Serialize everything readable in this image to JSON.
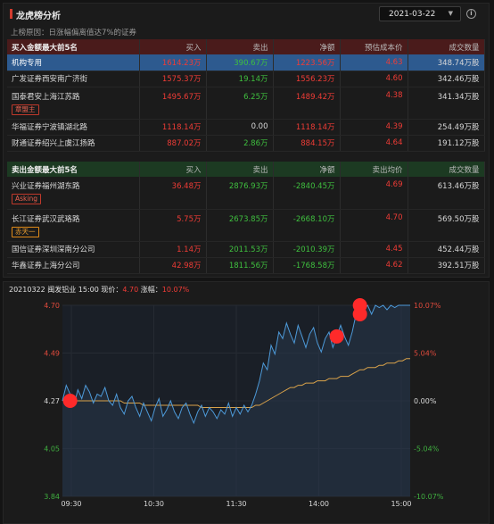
{
  "header": {
    "title": "龙虎榜分析",
    "date": "2021-03-22",
    "reason": "上榜原因：日涨幅偏离值达7%的证券"
  },
  "buy_table": {
    "columns": [
      "买入金额最大前5名",
      "买入",
      "卖出",
      "净额",
      "预估成本价",
      "成交数量"
    ],
    "rows": [
      {
        "name": "机构专用",
        "buy": "1614.23万",
        "sell": "390.67万",
        "net": "1223.56万",
        "cost": "4.63",
        "volume": "348.74万股",
        "selected": true,
        "tag": ""
      },
      {
        "name": "广发证券西安南广济街",
        "buy": "1575.37万",
        "sell": "19.14万",
        "net": "1556.23万",
        "cost": "4.60",
        "volume": "342.46万股",
        "selected": false,
        "tag": ""
      },
      {
        "name": "国泰君安上海江苏路",
        "buy": "1495.67万",
        "sell": "6.25万",
        "net": "1489.42万",
        "cost": "4.38",
        "volume": "341.34万股",
        "selected": false,
        "tag": "章盟主"
      },
      {
        "name": "华福证券宁波镇湖北路",
        "buy": "1118.14万",
        "sell": "0.00",
        "net": "1118.14万",
        "cost": "4.39",
        "volume": "254.49万股",
        "selected": false,
        "tag": ""
      },
      {
        "name": "财通证券绍兴上虞江扬路",
        "buy": "887.02万",
        "sell": "2.86万",
        "net": "884.15万",
        "cost": "4.64",
        "volume": "191.12万股",
        "selected": false,
        "tag": ""
      }
    ]
  },
  "sell_table": {
    "columns": [
      "卖出金额最大前5名",
      "买入",
      "卖出",
      "净额",
      "卖出均价",
      "成交数量"
    ],
    "rows": [
      {
        "name": "兴业证券福州湖东路",
        "buy": "36.48万",
        "sell": "2876.93万",
        "net": "-2840.45万",
        "cost": "4.69",
        "volume": "613.46万股",
        "tag": "Asking",
        "tag_style": "red"
      },
      {
        "name": "长江证券武汉武珞路",
        "buy": "5.75万",
        "sell": "2673.85万",
        "net": "-2668.10万",
        "cost": "4.70",
        "volume": "569.50万股",
        "tag": "赤天一",
        "tag_style": "orange"
      },
      {
        "name": "国信证券深圳深南分公司",
        "buy": "1.14万",
        "sell": "2011.53万",
        "net": "-2010.39万",
        "cost": "4.45",
        "volume": "452.44万股",
        "tag": ""
      },
      {
        "name": "华鑫证券上海分公司",
        "buy": "42.98万",
        "sell": "1811.56万",
        "net": "-1768.58万",
        "cost": "4.62",
        "volume": "392.51万股",
        "tag": ""
      }
    ]
  },
  "chart_info": {
    "prefix": "20210322 闽发铝业 15:00 现价：",
    "price": "4.70",
    "change_label": " 涨幅：",
    "change": "10.07%"
  },
  "chart_data": {
    "type": "line",
    "y_left_ticks": [
      "4.70",
      "4.49",
      "4.27",
      "4.05",
      "3.84"
    ],
    "y_right_ticks": [
      "10.07%",
      "5.04%",
      "0.00%",
      "-5.04%",
      "-10.07%"
    ],
    "x_ticks": [
      "09:30",
      "10:30",
      "11:30",
      "14:00",
      "15:00"
    ],
    "ylim": [
      3.84,
      4.7
    ],
    "prev_close": 4.27,
    "colors": {
      "price": "#4d9ad9",
      "avg": "#d9a24a",
      "marker": "#ff2a2a"
    },
    "series": [
      {
        "values": [
          4.27,
          4.34,
          4.3,
          4.25,
          4.32,
          4.28,
          4.34,
          4.31,
          4.26,
          4.3,
          4.29,
          4.33,
          4.27,
          4.25,
          4.3,
          4.24,
          4.21,
          4.27,
          4.29,
          4.24,
          4.2,
          4.26,
          4.22,
          4.18,
          4.24,
          4.28,
          4.2,
          4.23,
          4.27,
          4.22,
          4.19,
          4.24,
          4.26,
          4.21,
          4.17,
          4.22,
          4.25,
          4.2,
          4.24,
          4.22,
          4.19,
          4.23,
          4.21,
          4.26,
          4.2,
          4.24,
          4.21,
          4.25,
          4.22,
          4.25,
          4.3,
          4.36,
          4.44,
          4.41,
          4.52,
          4.48,
          4.58,
          4.55,
          4.62,
          4.57,
          4.53,
          4.61,
          4.56,
          4.51,
          4.57,
          4.6,
          4.53,
          4.49,
          4.55,
          4.58,
          4.51,
          4.56,
          4.61,
          4.56,
          4.52,
          4.58,
          4.66,
          4.7,
          4.68,
          4.7,
          4.66,
          4.7,
          4.69,
          4.7,
          4.68,
          4.7,
          4.69,
          4.7,
          4.7,
          4.7,
          4.7
        ]
      },
      {
        "values": [
          4.27,
          4.28,
          4.28,
          4.27,
          4.27,
          4.27,
          4.27,
          4.27,
          4.27,
          4.27,
          4.27,
          4.27,
          4.27,
          4.27,
          4.27,
          4.27,
          4.26,
          4.26,
          4.26,
          4.26,
          4.26,
          4.25,
          4.25,
          4.25,
          4.25,
          4.25,
          4.25,
          4.25,
          4.25,
          4.25,
          4.25,
          4.25,
          4.25,
          4.25,
          4.25,
          4.25,
          4.24,
          4.24,
          4.24,
          4.24,
          4.24,
          4.24,
          4.24,
          4.24,
          4.24,
          4.24,
          4.24,
          4.24,
          4.24,
          4.24,
          4.25,
          4.25,
          4.26,
          4.27,
          4.28,
          4.29,
          4.3,
          4.31,
          4.32,
          4.33,
          4.33,
          4.34,
          4.34,
          4.35,
          4.35,
          4.35,
          4.36,
          4.36,
          4.36,
          4.37,
          4.37,
          4.37,
          4.38,
          4.38,
          4.38,
          4.39,
          4.4,
          4.41,
          4.41,
          4.42,
          4.42,
          4.42,
          4.43,
          4.43,
          4.44,
          4.44,
          4.44,
          4.45,
          4.45,
          4.46,
          4.46
        ]
      }
    ],
    "markers": [
      {
        "time_index": 2,
        "price": 4.27
      },
      {
        "time_index": 71,
        "price": 4.56
      },
      {
        "time_index": 77,
        "price": 4.7
      },
      {
        "time_index": 77,
        "price": 4.66
      }
    ]
  }
}
